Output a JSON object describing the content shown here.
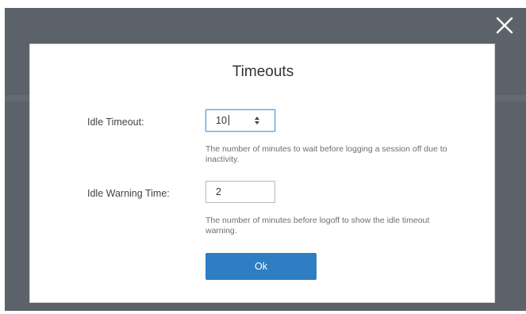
{
  "dialog": {
    "title": "Timeouts",
    "close_icon": "close-icon",
    "idle_timeout": {
      "label": "Idle Timeout:",
      "value": "10",
      "help": "The number of minutes to wait before logging a session off due to inactivity."
    },
    "idle_warning": {
      "label": "Idle Warning Time:",
      "value": "2",
      "help": "The number of minutes before logoff to show the idle timeout warning."
    },
    "ok_label": "Ok"
  },
  "colors": {
    "overlay": "#5c6269",
    "accent": "#2f7ec3",
    "focus_border": "#4b9be0"
  }
}
